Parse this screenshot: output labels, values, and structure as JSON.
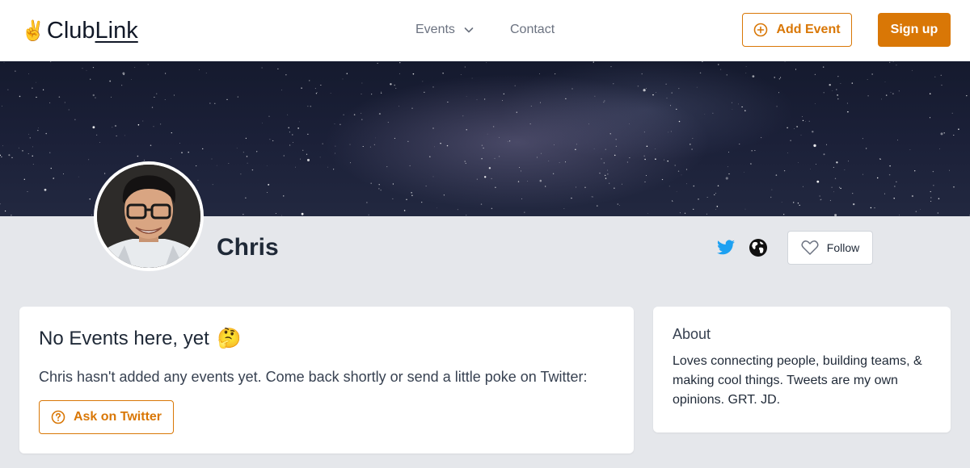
{
  "header": {
    "logo_emoji": "✌️",
    "logo_text_prefix": "Club",
    "logo_text_link": "Link",
    "nav": {
      "events_label": "Events",
      "contact_label": "Contact"
    },
    "add_event_label": "Add Event",
    "signup_label": "Sign up"
  },
  "profile": {
    "name": "Chris",
    "banner_theme": "starry-night-sky",
    "follow_label": "Follow",
    "social": [
      "twitter-icon",
      "globe-icon"
    ]
  },
  "events_card": {
    "title": "No Events here, yet",
    "title_emoji": "🤔",
    "message": "Chris hasn't added any events yet. Come back shortly or send a little poke on Twitter:",
    "ask_label": "Ask on Twitter"
  },
  "about_card": {
    "title": "About",
    "text": "Loves connecting people, building teams, & making cool things. Tweets are my own opinions. GRT. JD."
  },
  "colors": {
    "accent": "#d97706",
    "background": "#e5e7eb",
    "twitter": "#1da1f2"
  }
}
